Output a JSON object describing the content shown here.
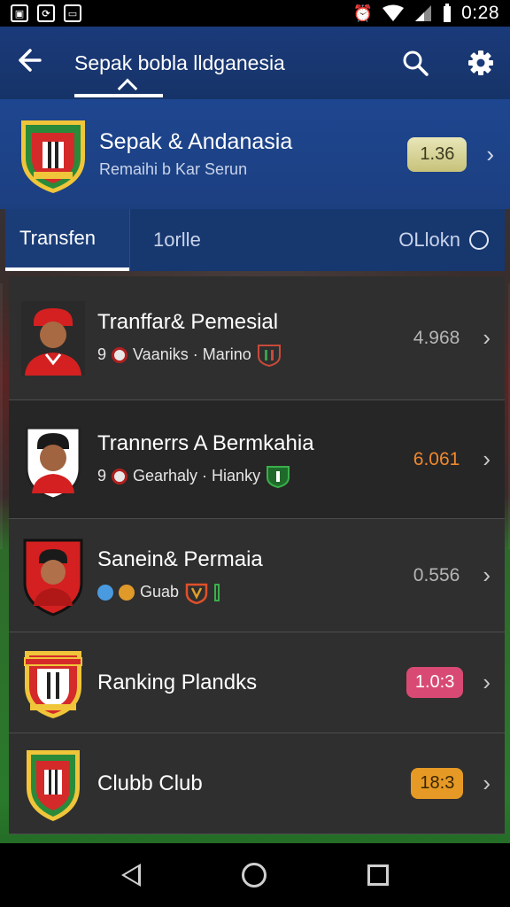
{
  "status_bar": {
    "time": "0:28",
    "left_icons": [
      "image-icon",
      "sync-icon",
      "gallery-icon"
    ],
    "right_icons": [
      "alarm-icon",
      "wifi-icon",
      "signal-icon",
      "battery-icon"
    ]
  },
  "app_bar": {
    "title": "Sepak bobla lldganesia",
    "back_icon": "back-arrow-icon",
    "search_icon": "search-icon",
    "settings_icon": "gear-icon"
  },
  "club": {
    "name": "Sepak & Andanasia",
    "subtitle": "Remaihi b Kar Serun",
    "badge": "1.36",
    "crest_icon": "club-crest-icon",
    "colors": {
      "badge_bg": "#d6d28a",
      "header_bg": "#1e4690"
    }
  },
  "tabs": [
    {
      "label": "Transfen",
      "active": true
    },
    {
      "label": "1orlle",
      "active": false
    },
    {
      "label": "OLlokn",
      "active": false
    }
  ],
  "list": [
    {
      "title": "Tranffar& Pemesial",
      "meta_prefix": "9",
      "meta_text": "Vaaniks · Marino",
      "value": "4.968",
      "value_style": "gray",
      "avatar": "player-avatar-icon"
    },
    {
      "title": "Trannerrs A Bermkahia",
      "meta_prefix": "9",
      "meta_text": "Gearhaly · Hianky",
      "value": "6.061",
      "value_style": "orange",
      "avatar": "player-avatar-icon"
    },
    {
      "title": "Sanein& Permaia",
      "meta_prefix": "",
      "meta_text": "Guab",
      "value": "0.556",
      "value_style": "gray",
      "avatar": "player-avatar-icon"
    },
    {
      "title": "Ranking Plandks",
      "value": "1.0:3",
      "value_style": "pink-pill",
      "avatar": "club-crest-icon"
    },
    {
      "title": "Clubb Club",
      "value": "18:3",
      "value_style": "orange-pill",
      "avatar": "club-crest-icon"
    }
  ],
  "nav_bar": {
    "icons": [
      "nav-back-icon",
      "nav-home-icon",
      "nav-recent-icon"
    ]
  }
}
